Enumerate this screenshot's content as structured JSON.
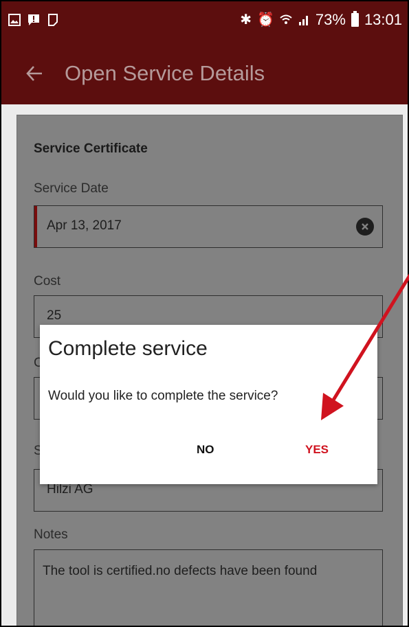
{
  "status_bar": {
    "battery": "73%",
    "time": "13:01",
    "icons": [
      "image-icon",
      "message-icon",
      "screenshot-icon",
      "bluetooth-icon",
      "alarm-icon",
      "wifi-icon",
      "signal-icon",
      "battery-icon"
    ]
  },
  "app_bar": {
    "title": "Open Service Details",
    "back_icon": "arrow-left-icon"
  },
  "form": {
    "section_title": "Service Certificate",
    "service_date": {
      "label": "Service Date",
      "value": "Apr 13, 2017"
    },
    "cost": {
      "label": "Cost",
      "value": "25"
    },
    "partial_label_1": "C",
    "partial_label_2": "S",
    "supplier_value": "Hilzi AG",
    "notes": {
      "label": "Notes",
      "value": "The tool is certified.no defects have been found"
    }
  },
  "dialog": {
    "title": "Complete service",
    "message": "Would you like to complete the service?",
    "no_label": "NO",
    "yes_label": "YES"
  },
  "colors": {
    "app_bar": "#5c0e0e",
    "accent": "#d0131f",
    "overlay_arrow": "#d0131f"
  }
}
